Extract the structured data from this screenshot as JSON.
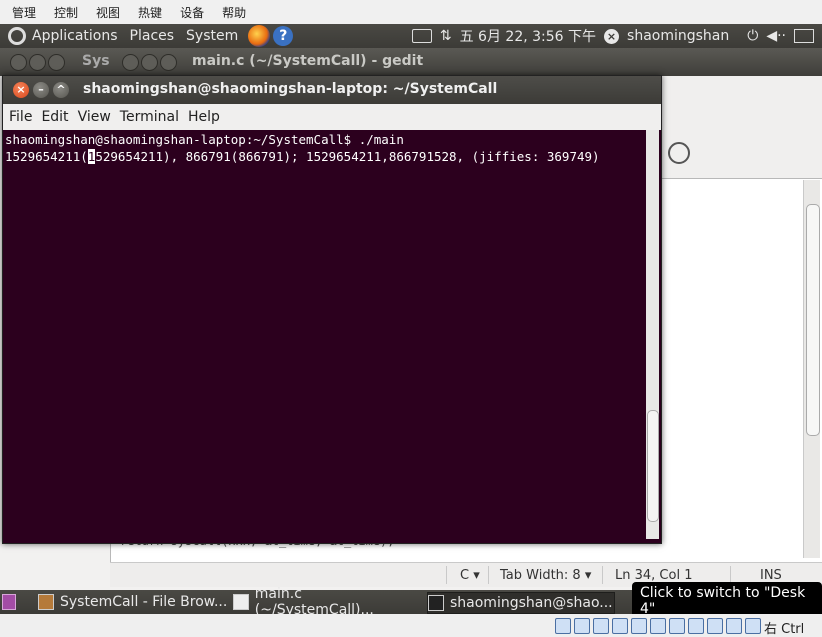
{
  "vm_menu": [
    "管理",
    "控制",
    "视图",
    "热键",
    "设备",
    "帮助"
  ],
  "panel": {
    "menus": [
      "Applications",
      "Places",
      "System"
    ],
    "datetime": "五 6月 22, 3:56 下午",
    "username": "shaomingshan"
  },
  "gedit": {
    "title_tab1": "Sys",
    "title": "main.c (~/SystemCall) - gedit",
    "code_line": "return syscall(xxx, &t_time, &t_time);",
    "status": {
      "lang": "C ▾",
      "tab_width": "Tab Width:  8 ▾",
      "position": "Ln 34, Col 1",
      "mode": "INS"
    }
  },
  "terminal": {
    "title": "shaomingshan@shaomingshan-laptop: ~/SystemCall",
    "menu": [
      "File",
      "Edit",
      "View",
      "Terminal",
      "Help"
    ],
    "line1": "shaomingshan@shaomingshan-laptop:~/SystemCall$ ./main",
    "line2_pre": "1529654211(",
    "line2_cursor": "1",
    "line2_post": "529654211), 866791(866791); 1529654211,866791528, (jiffies: 369749)"
  },
  "taskbar": {
    "items": [
      "SystemCall - File Brow...",
      "main.c (~/SystemCall)...",
      "shaomingshan@shao..."
    ],
    "tooltip": "Click to switch to \"Desk 4\""
  },
  "host_status": {
    "key_label": "右 Ctrl"
  }
}
